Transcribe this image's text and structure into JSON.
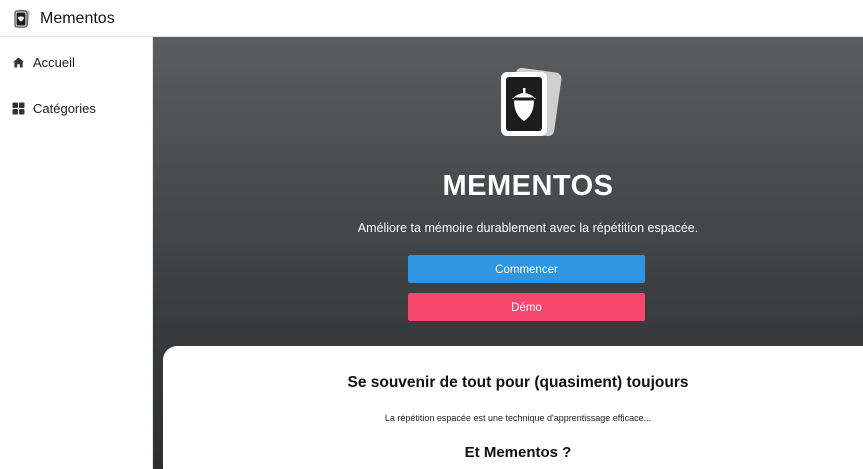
{
  "app": {
    "title": "Mementos",
    "logo_icon": "card-acorn-icon"
  },
  "sidebar": {
    "items": [
      {
        "label": "Accueil",
        "icon": "home-icon"
      },
      {
        "label": "Catégories",
        "icon": "grid-icon"
      }
    ]
  },
  "hero": {
    "title": "MEMENTOS",
    "subtitle": "Améliore ta mémoire durablement avec la répétition espacée.",
    "start_label": "Commencer",
    "demo_label": "Démo",
    "colors": {
      "start": "#2f95e0",
      "demo": "#f5476f"
    }
  },
  "card": {
    "title": "Se souvenir de tout pour (quasiment) toujours",
    "text": "La répétition espacée est une technique d'apprentissage efficace...",
    "subtitle": "Et Mementos ?"
  }
}
